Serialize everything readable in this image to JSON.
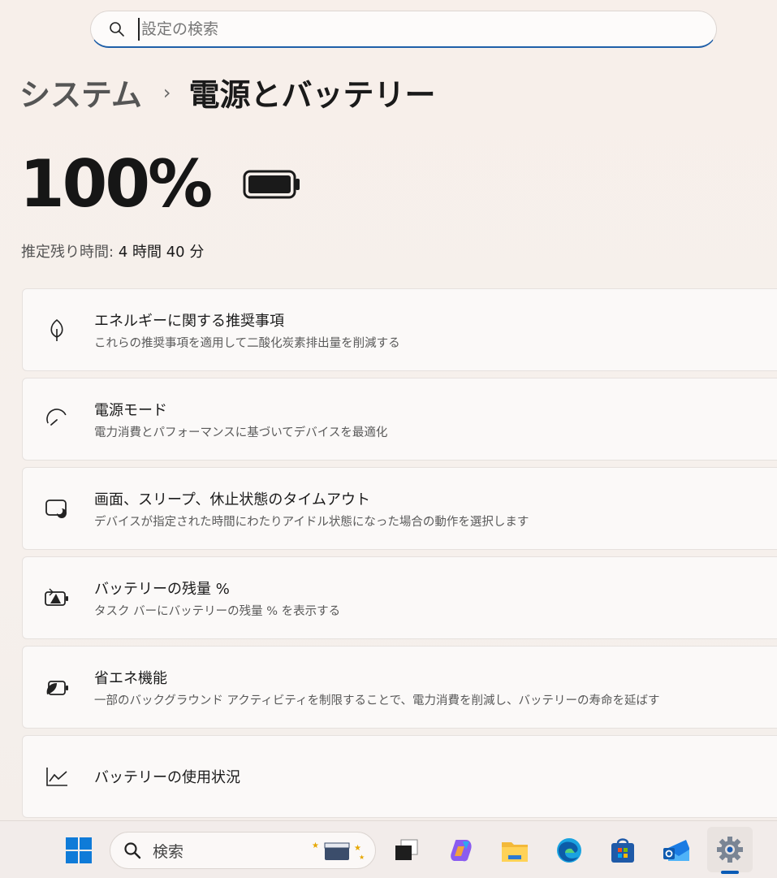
{
  "search": {
    "placeholder": "設定の検索"
  },
  "breadcrumb": {
    "parent": "システム",
    "separator": "›",
    "current": "電源とバッテリー"
  },
  "battery": {
    "percent_text": "100%",
    "remaining_label": "推定残り時間:",
    "remaining_value": "4 時間 40 分",
    "level": 1.0
  },
  "cards": [
    {
      "icon": "leaf-icon",
      "title": "エネルギーに関する推奨事項",
      "desc": "これらの推奨事項を適用して二酸化炭素排出量を削減する"
    },
    {
      "icon": "power-mode-icon",
      "title": "電源モード",
      "desc": "電力消費とパフォーマンスに基づいてデバイスを最適化"
    },
    {
      "icon": "screen-sleep-icon",
      "title": "画面、スリープ、休止状態のタイムアウト",
      "desc": "デバイスが指定された時間にわたりアイドル状態になった場合の動作を選択します"
    },
    {
      "icon": "battery-percent-icon",
      "title": "バッテリーの残量 %",
      "desc": "タスク バーにバッテリーの残量 % を表示する"
    },
    {
      "icon": "energy-saver-icon",
      "title": "省エネ機能",
      "desc": "一部のバックグラウンド アクティビティを制限することで、電力消費を削減し、バッテリーの寿命を延ばす"
    },
    {
      "icon": "usage-chart-icon",
      "title": "バッテリーの使用状況",
      "desc": ""
    }
  ],
  "taskbar": {
    "search_text": "検索",
    "apps": [
      "windows-start-icon",
      "task-view-icon",
      "copilot-icon",
      "file-explorer-icon",
      "edge-icon",
      "store-icon",
      "outlook-icon",
      "settings-icon"
    ]
  },
  "colors": {
    "accent": "#0a5bb5",
    "background": "#f7efea",
    "card": "#fbf9f8"
  }
}
